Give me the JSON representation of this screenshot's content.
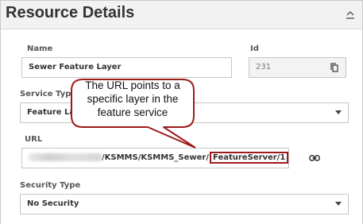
{
  "header": {
    "title": "Resource Details",
    "collapse_icon": "chevron-up-icon"
  },
  "fields": {
    "name": {
      "label": "Name",
      "value": "Sewer Feature Layer"
    },
    "id": {
      "label": "Id",
      "value": "231",
      "icon": "copy-icon"
    },
    "service_type": {
      "label": "Service Type",
      "value": "Feature Layer"
    },
    "url": {
      "label": "URL",
      "value_prefix": "/KSMMS/KSMMS_Sewer/",
      "value_highlight": "FeatureServer/1",
      "icon": "link-icon"
    },
    "security_type": {
      "label": "Security Type",
      "value": "No Security"
    }
  },
  "callout": {
    "text": "The URL points to a specific layer in the feature service",
    "border_color": "#9e1b1b"
  }
}
